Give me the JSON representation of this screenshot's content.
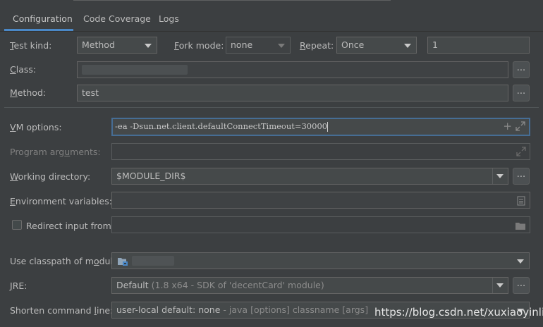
{
  "tabs": [
    {
      "label": "Configuration",
      "active": true
    },
    {
      "label": "Code Coverage",
      "active": false
    },
    {
      "label": "Logs",
      "active": false
    }
  ],
  "test_kind": {
    "label": "Test kind:",
    "mnemonic": "T",
    "value": "Method"
  },
  "fork_mode": {
    "label": "Fork mode:",
    "mnemonic": "F",
    "value": "none"
  },
  "repeat": {
    "label": "Repeat:",
    "mnemonic": "R",
    "value": "Once",
    "count": "1"
  },
  "class_field": {
    "label": "Class:",
    "mnemonic": "C",
    "browse": "..."
  },
  "method_field": {
    "label": "Method:",
    "mnemonic": "M",
    "value": "test",
    "browse": "..."
  },
  "vm_options": {
    "label": "VM options:",
    "mnemonic": "V",
    "value": "-ea  -Dsun.net.client.defaultConnectTimeout=30000"
  },
  "program_args": {
    "label": "Program arguments:",
    "mnemonic": "u"
  },
  "working_dir": {
    "label": "Working directory:",
    "mnemonic": "W",
    "value": "$MODULE_DIR$",
    "browse": "..."
  },
  "env_vars": {
    "label": "Environment variables:",
    "mnemonic": "E"
  },
  "redirect_input": {
    "label": "Redirect input from:",
    "checked": false
  },
  "classpath": {
    "label": "Use classpath of module:",
    "mnemonic": "o"
  },
  "jre": {
    "label": "JRE:",
    "mnemonic": "J",
    "value_main": "Default",
    "value_detail": "(1.8 x64 - SDK of 'decentCard' module)",
    "browse": "..."
  },
  "shorten": {
    "label": "Shorten command line:",
    "mnemonic": "l",
    "value_main": "user-local default: none",
    "value_detail": "- java [options] classname [args]"
  },
  "watermark": "https://blog.csdn.net/xuxiaoyinliu",
  "colors": {
    "accent": "#4a88c7",
    "background": "#3c3f41",
    "field": "#45494a"
  }
}
